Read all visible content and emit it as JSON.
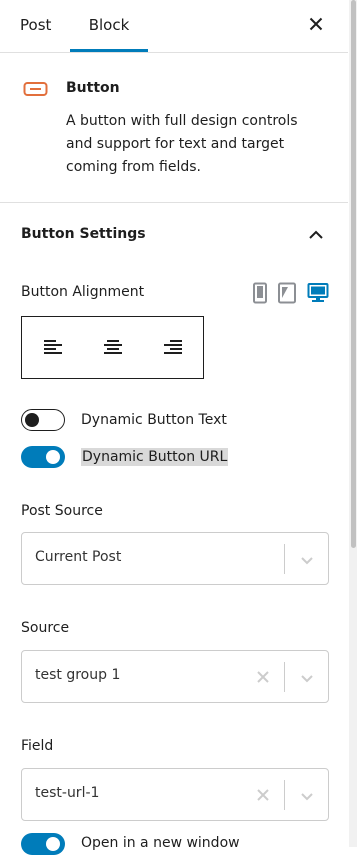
{
  "tabs": {
    "post": "Post",
    "block": "Block"
  },
  "block": {
    "title": "Button",
    "description": "A button with full design controls and support for text and target coming from fields."
  },
  "panel": {
    "title": "Button Settings"
  },
  "alignment": {
    "label": "Button Alignment"
  },
  "toggles": {
    "dynamic_text": "Dynamic Button Text",
    "dynamic_url": "Dynamic Button URL",
    "new_window": "Open in a new window"
  },
  "post_source": {
    "label": "Post Source",
    "value": "Current Post"
  },
  "source": {
    "label": "Source",
    "value": "test group 1"
  },
  "field": {
    "label": "Field",
    "value": "test-url-1"
  },
  "colors": {
    "accent": "#007cba",
    "block_icon": "#e26f3c"
  }
}
